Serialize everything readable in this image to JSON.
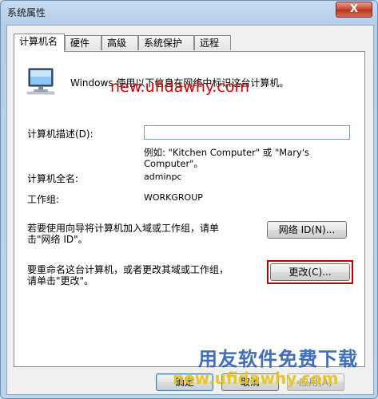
{
  "window": {
    "title": "系统属性",
    "close_label": "X"
  },
  "tabs": [
    {
      "label": "计算机名"
    },
    {
      "label": "硬件"
    },
    {
      "label": "高级"
    },
    {
      "label": "系统保护"
    },
    {
      "label": "远程"
    }
  ],
  "intro_text": "Windows 使用以下信息在网络中标识这台计算机。",
  "description": {
    "label": "计算机描述(D):",
    "value": "",
    "example_line1": "例如: \"Kitchen Computer\" 或 \"Mary's",
    "example_line2": "Computer\"。"
  },
  "full_name": {
    "label": "计算机全名:",
    "value": "adminpc"
  },
  "workgroup": {
    "label": "工作组:",
    "value": "WORKGROUP"
  },
  "network_id": {
    "text_line1": "若要使用向导将计算机加入域或工作组，请单",
    "text_line2": "击\"网络 ID\"。",
    "button": "网络 ID(N)..."
  },
  "rename": {
    "text_line1": "要重命名这台计算机，或者更改其域或工作组，",
    "text_line2": "请单击\"更改\"。",
    "button": "更改(C)..."
  },
  "footer": {
    "ok": "确定",
    "cancel": "取消",
    "apply": "应用(A)"
  },
  "watermark": {
    "url_top": "new.ufidawhy.com",
    "text_cn": "用友软件免费下载",
    "url_bottom": "new.ufidawhy.com"
  }
}
